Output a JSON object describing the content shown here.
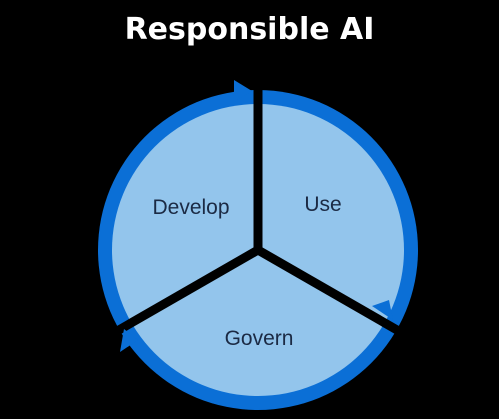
{
  "title": "Responsible AI",
  "segments": [
    {
      "label": "Develop"
    },
    {
      "label": "Use"
    },
    {
      "label": "Govern"
    }
  ],
  "colors": {
    "background": "#000000",
    "ring": "#0b6fd6",
    "segment_fill": "#93c5ec",
    "label_text": "#1b2a44",
    "title_text": "#ffffff"
  }
}
